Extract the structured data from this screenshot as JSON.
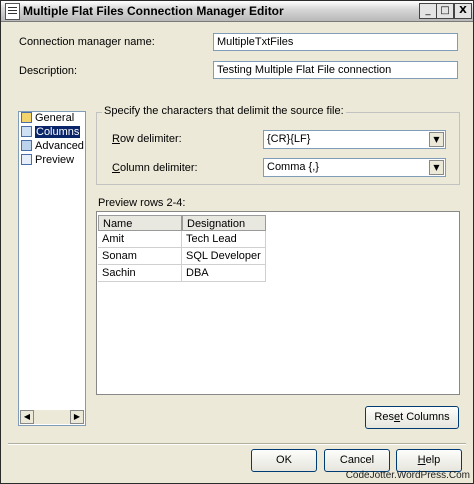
{
  "window": {
    "title": "Multiple Flat Files Connection Manager Editor",
    "controls": {
      "minimize": "_",
      "maximize": "□",
      "close": "X"
    }
  },
  "form": {
    "connection_name_label": "Connection manager name:",
    "connection_name_value": "MultipleTxtFiles",
    "description_label": "Description:",
    "description_value": "Testing Multiple Flat File connection"
  },
  "nav": {
    "items": [
      {
        "label": "General",
        "icon": "general-icon",
        "selected": false
      },
      {
        "label": "Columns",
        "icon": "columns-icon",
        "selected": true
      },
      {
        "label": "Advanced",
        "icon": "advanced-icon",
        "selected": false
      },
      {
        "label": "Preview",
        "icon": "preview-icon",
        "selected": false
      }
    ]
  },
  "delimiters": {
    "group_title": "Specify the characters that delimit the source file:",
    "row_label_pre": "",
    "row_label_key": "R",
    "row_label_post": "ow delimiter:",
    "row_value": "{CR}{LF}",
    "column_label_key": "C",
    "column_label_post": "olumn delimiter:",
    "column_value": "Comma {,}"
  },
  "preview": {
    "label": "Preview rows 2-4:",
    "columns": [
      "Name",
      "Designation"
    ],
    "rows": [
      [
        "Amit",
        "Tech Lead"
      ],
      [
        "Sonam",
        "SQL Developer"
      ],
      [
        "Sachin",
        "DBA"
      ]
    ]
  },
  "buttons": {
    "reset_pre": "Res",
    "reset_key": "e",
    "reset_post": "t Columns",
    "ok": "OK",
    "cancel": "Cancel",
    "help_key": "H",
    "help_post": "elp"
  },
  "watermark": "CodeJotter.WordPress.Com",
  "colors": {
    "selection": "#0a246a",
    "dialog_bg": "#ece9d8",
    "border_blue": "#7f9db9"
  }
}
